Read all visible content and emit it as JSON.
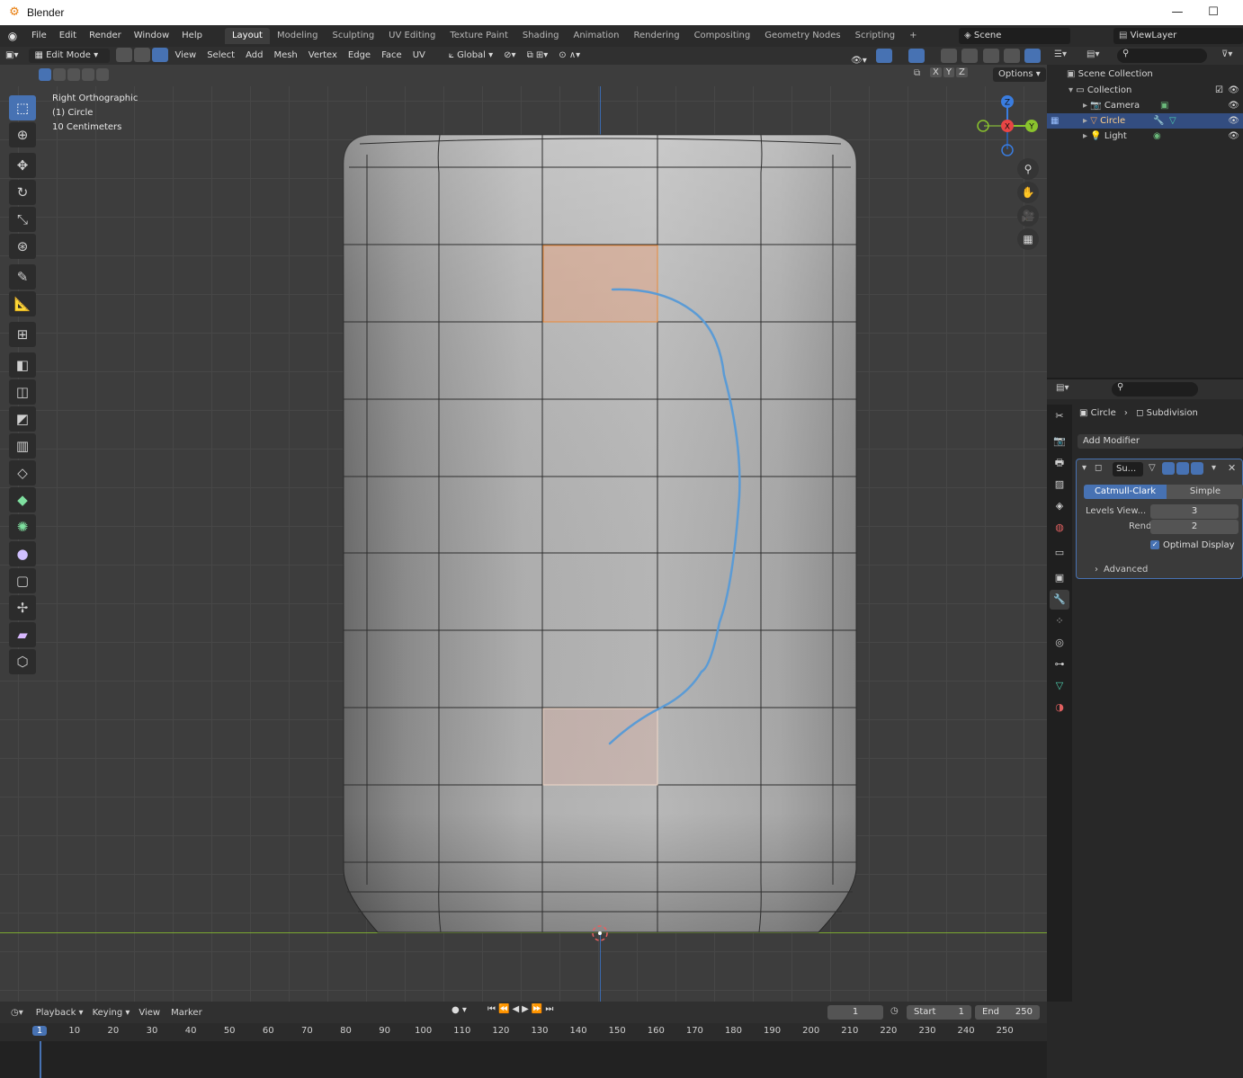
{
  "window": {
    "title": "Blender",
    "minimize": "—",
    "maximize": "☐"
  },
  "menubar": {
    "menus": [
      "File",
      "Edit",
      "Render",
      "Window",
      "Help"
    ],
    "workspaces": [
      "Layout",
      "Modeling",
      "Sculpting",
      "UV Editing",
      "Texture Paint",
      "Shading",
      "Animation",
      "Rendering",
      "Compositing",
      "Geometry Nodes",
      "Scripting"
    ],
    "active_workspace": "Layout",
    "add_workspace": "+",
    "scene": "Scene",
    "view_layer": "ViewLayer"
  },
  "viewport_header": {
    "mode": "Edit Mode",
    "menus": [
      "View",
      "Select",
      "Add",
      "Mesh",
      "Vertex",
      "Edge",
      "Face",
      "UV"
    ],
    "orientation": "Global",
    "axes": [
      "X",
      "Y",
      "Z"
    ],
    "options": "Options"
  },
  "viewport_overlay": {
    "view_name": "Right Orthographic",
    "object_name": "(1) Circle",
    "scale": "10 Centimeters"
  },
  "gizmo": {
    "z": "Z",
    "x": "X",
    "y": "Y"
  },
  "outliner": {
    "scene_collection": "Scene Collection",
    "collection": "Collection",
    "items": [
      {
        "name": "Camera",
        "selected": false,
        "color": "#e8a060"
      },
      {
        "name": "Circle",
        "selected": true,
        "color": "#e8a060"
      },
      {
        "name": "Light",
        "selected": false,
        "color": "#e8a060"
      }
    ]
  },
  "properties": {
    "breadcrumb_object": "Circle",
    "breadcrumb_modifier": "Subdivision",
    "add_modifier": "Add Modifier",
    "modifier_name": "Su...",
    "mode_catmull": "Catmull-Clark",
    "mode_simple": "Simple",
    "levels_label": "Levels View...",
    "levels_value": "3",
    "render_label": "Render",
    "render_value": "2",
    "optimal_display": "Optimal Display",
    "advanced": "Advanced"
  },
  "timeline": {
    "menus": [
      "Playback",
      "Keying",
      "View",
      "Marker"
    ],
    "current_frame": "1",
    "start_label": "Start",
    "start_value": "1",
    "end_label": "End",
    "end_value": "250",
    "ruler_marks": [
      "1",
      "10",
      "20",
      "30",
      "40",
      "50",
      "60",
      "70",
      "80",
      "90",
      "100",
      "110",
      "120",
      "130",
      "140",
      "150",
      "160",
      "170",
      "180",
      "190",
      "200",
      "210",
      "220",
      "230",
      "240",
      "250"
    ]
  },
  "colors": {
    "accent": "#4772b3",
    "selected_face": "#e8a07a",
    "annotation_stroke": "#5b9bd5",
    "x_axis": "#e84545",
    "y_axis": "#8ac32d",
    "z_axis": "#3a7de0"
  }
}
